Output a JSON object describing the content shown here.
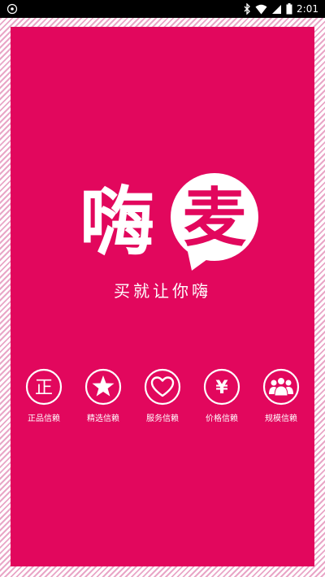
{
  "status_bar": {
    "time": "2:01",
    "icons": [
      "app-notification-icon",
      "bluetooth-icon",
      "wifi-icon",
      "signal-icon",
      "battery-icon"
    ]
  },
  "colors": {
    "background": "#e2075d",
    "frame_stripes": "#e9a6c7",
    "foreground": "#ffffff"
  },
  "logo": {
    "char_1": "嗨",
    "char_2": "麦"
  },
  "slogan": "买就让你嗨",
  "features": [
    {
      "label": "正品信赖",
      "icon": "zheng-badge-icon",
      "glyph": "正"
    },
    {
      "label": "精选信赖",
      "icon": "star-badge-icon"
    },
    {
      "label": "服务信赖",
      "icon": "heart-badge-icon"
    },
    {
      "label": "价格信赖",
      "icon": "yen-badge-icon",
      "glyph": "¥"
    },
    {
      "label": "规模信赖",
      "icon": "group-badge-icon"
    }
  ]
}
